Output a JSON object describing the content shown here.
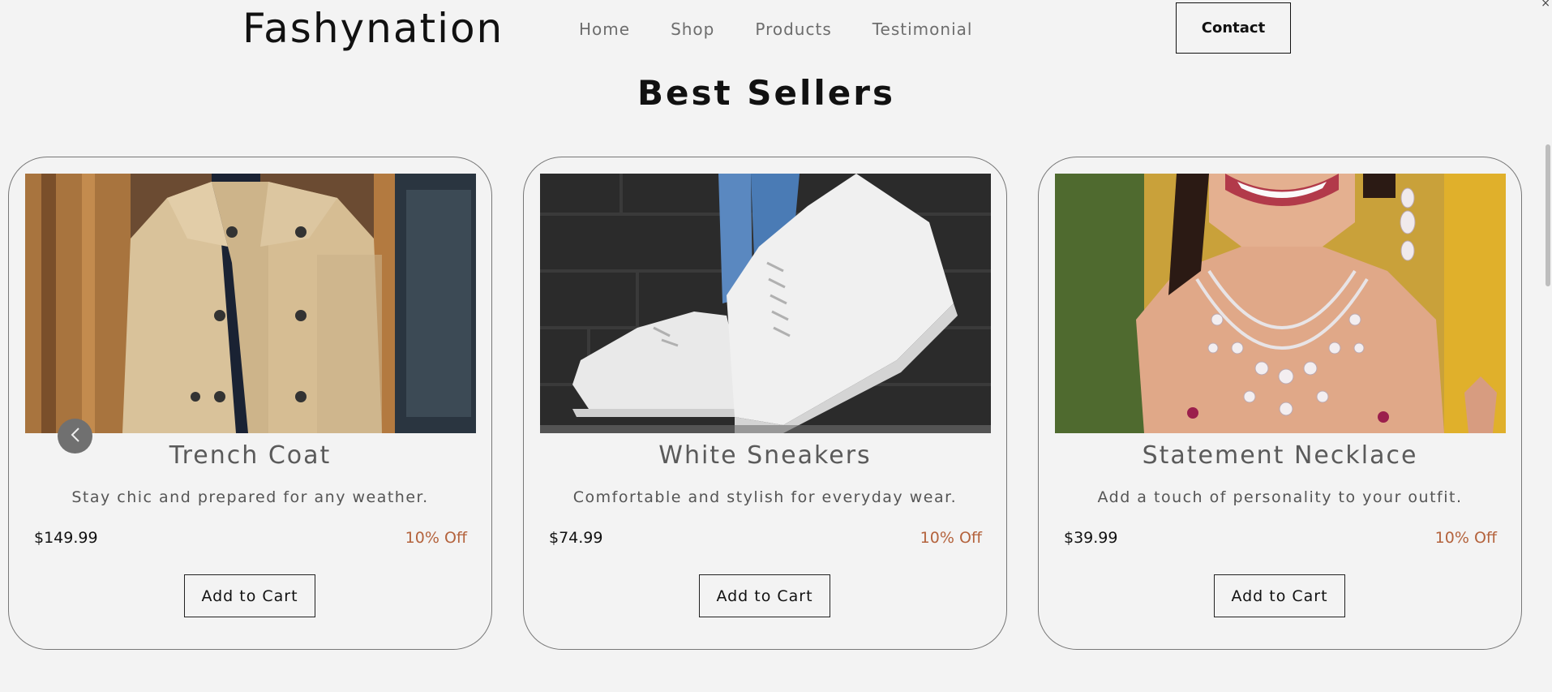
{
  "header": {
    "logo": "Fashynation",
    "nav": [
      "Home",
      "Shop",
      "Products",
      "Testimonial"
    ],
    "contact_label": "Contact"
  },
  "section": {
    "title": "Best Sellers"
  },
  "products": [
    {
      "name": "Trench Coat",
      "description": "Stay chic and prepared for any weather.",
      "price": "$149.99",
      "discount": "10% Off",
      "button": "Add to Cart"
    },
    {
      "name": "White Sneakers",
      "description": "Comfortable and stylish for everyday wear.",
      "price": "$74.99",
      "discount": "10% Off",
      "button": "Add to Cart"
    },
    {
      "name": "Statement Necklace",
      "description": "Add a touch of personality to your outfit.",
      "price": "$39.99",
      "discount": "10% Off",
      "button": "Add to Cart"
    }
  ],
  "colors": {
    "background": "#f3f3f3",
    "discount": "#b4633d",
    "card_border": "#777777"
  },
  "icons": {
    "carousel_prev": "chevron-left-icon"
  }
}
